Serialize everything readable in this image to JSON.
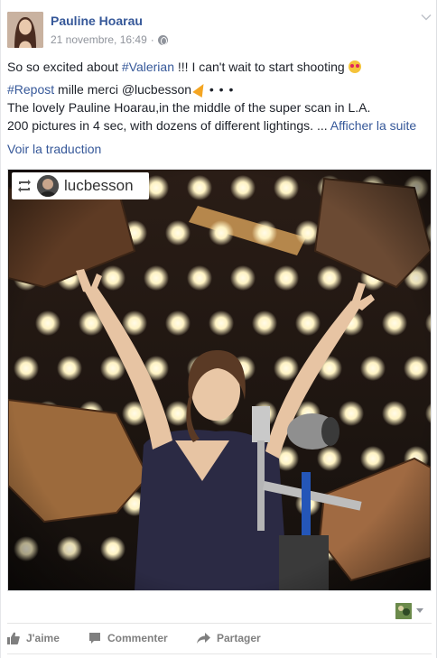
{
  "post": {
    "author": "Pauline Hoarau",
    "timestamp": "21 novembre, 16:49",
    "separator": "·",
    "privacy_icon": "globe-icon",
    "line1_before": "So so excited about ",
    "line1_hashtag": "#Valerian",
    "line1_after": " !!! I can't wait to start shooting ",
    "line2_hashtag": "#Repost",
    "line2_text": " mille merci @lucbesson ",
    "line2_dots": "• • •",
    "line3": "The lovely Pauline Hoarau,in the middle of the super scan in L.A.",
    "line4": "200 pictures in 4 sec, with dozens of different lightings. ... ",
    "see_more": "Afficher la suite",
    "translate": "Voir la traduction"
  },
  "repost": {
    "username": "lucbesson",
    "icon": "repost-icon"
  },
  "actions": {
    "like": "J'aime",
    "comment": "Commenter",
    "share": "Partager"
  },
  "colors": {
    "link": "#365899",
    "meta": "#90949c",
    "action": "#7f7f7f",
    "text": "#1d2129"
  }
}
